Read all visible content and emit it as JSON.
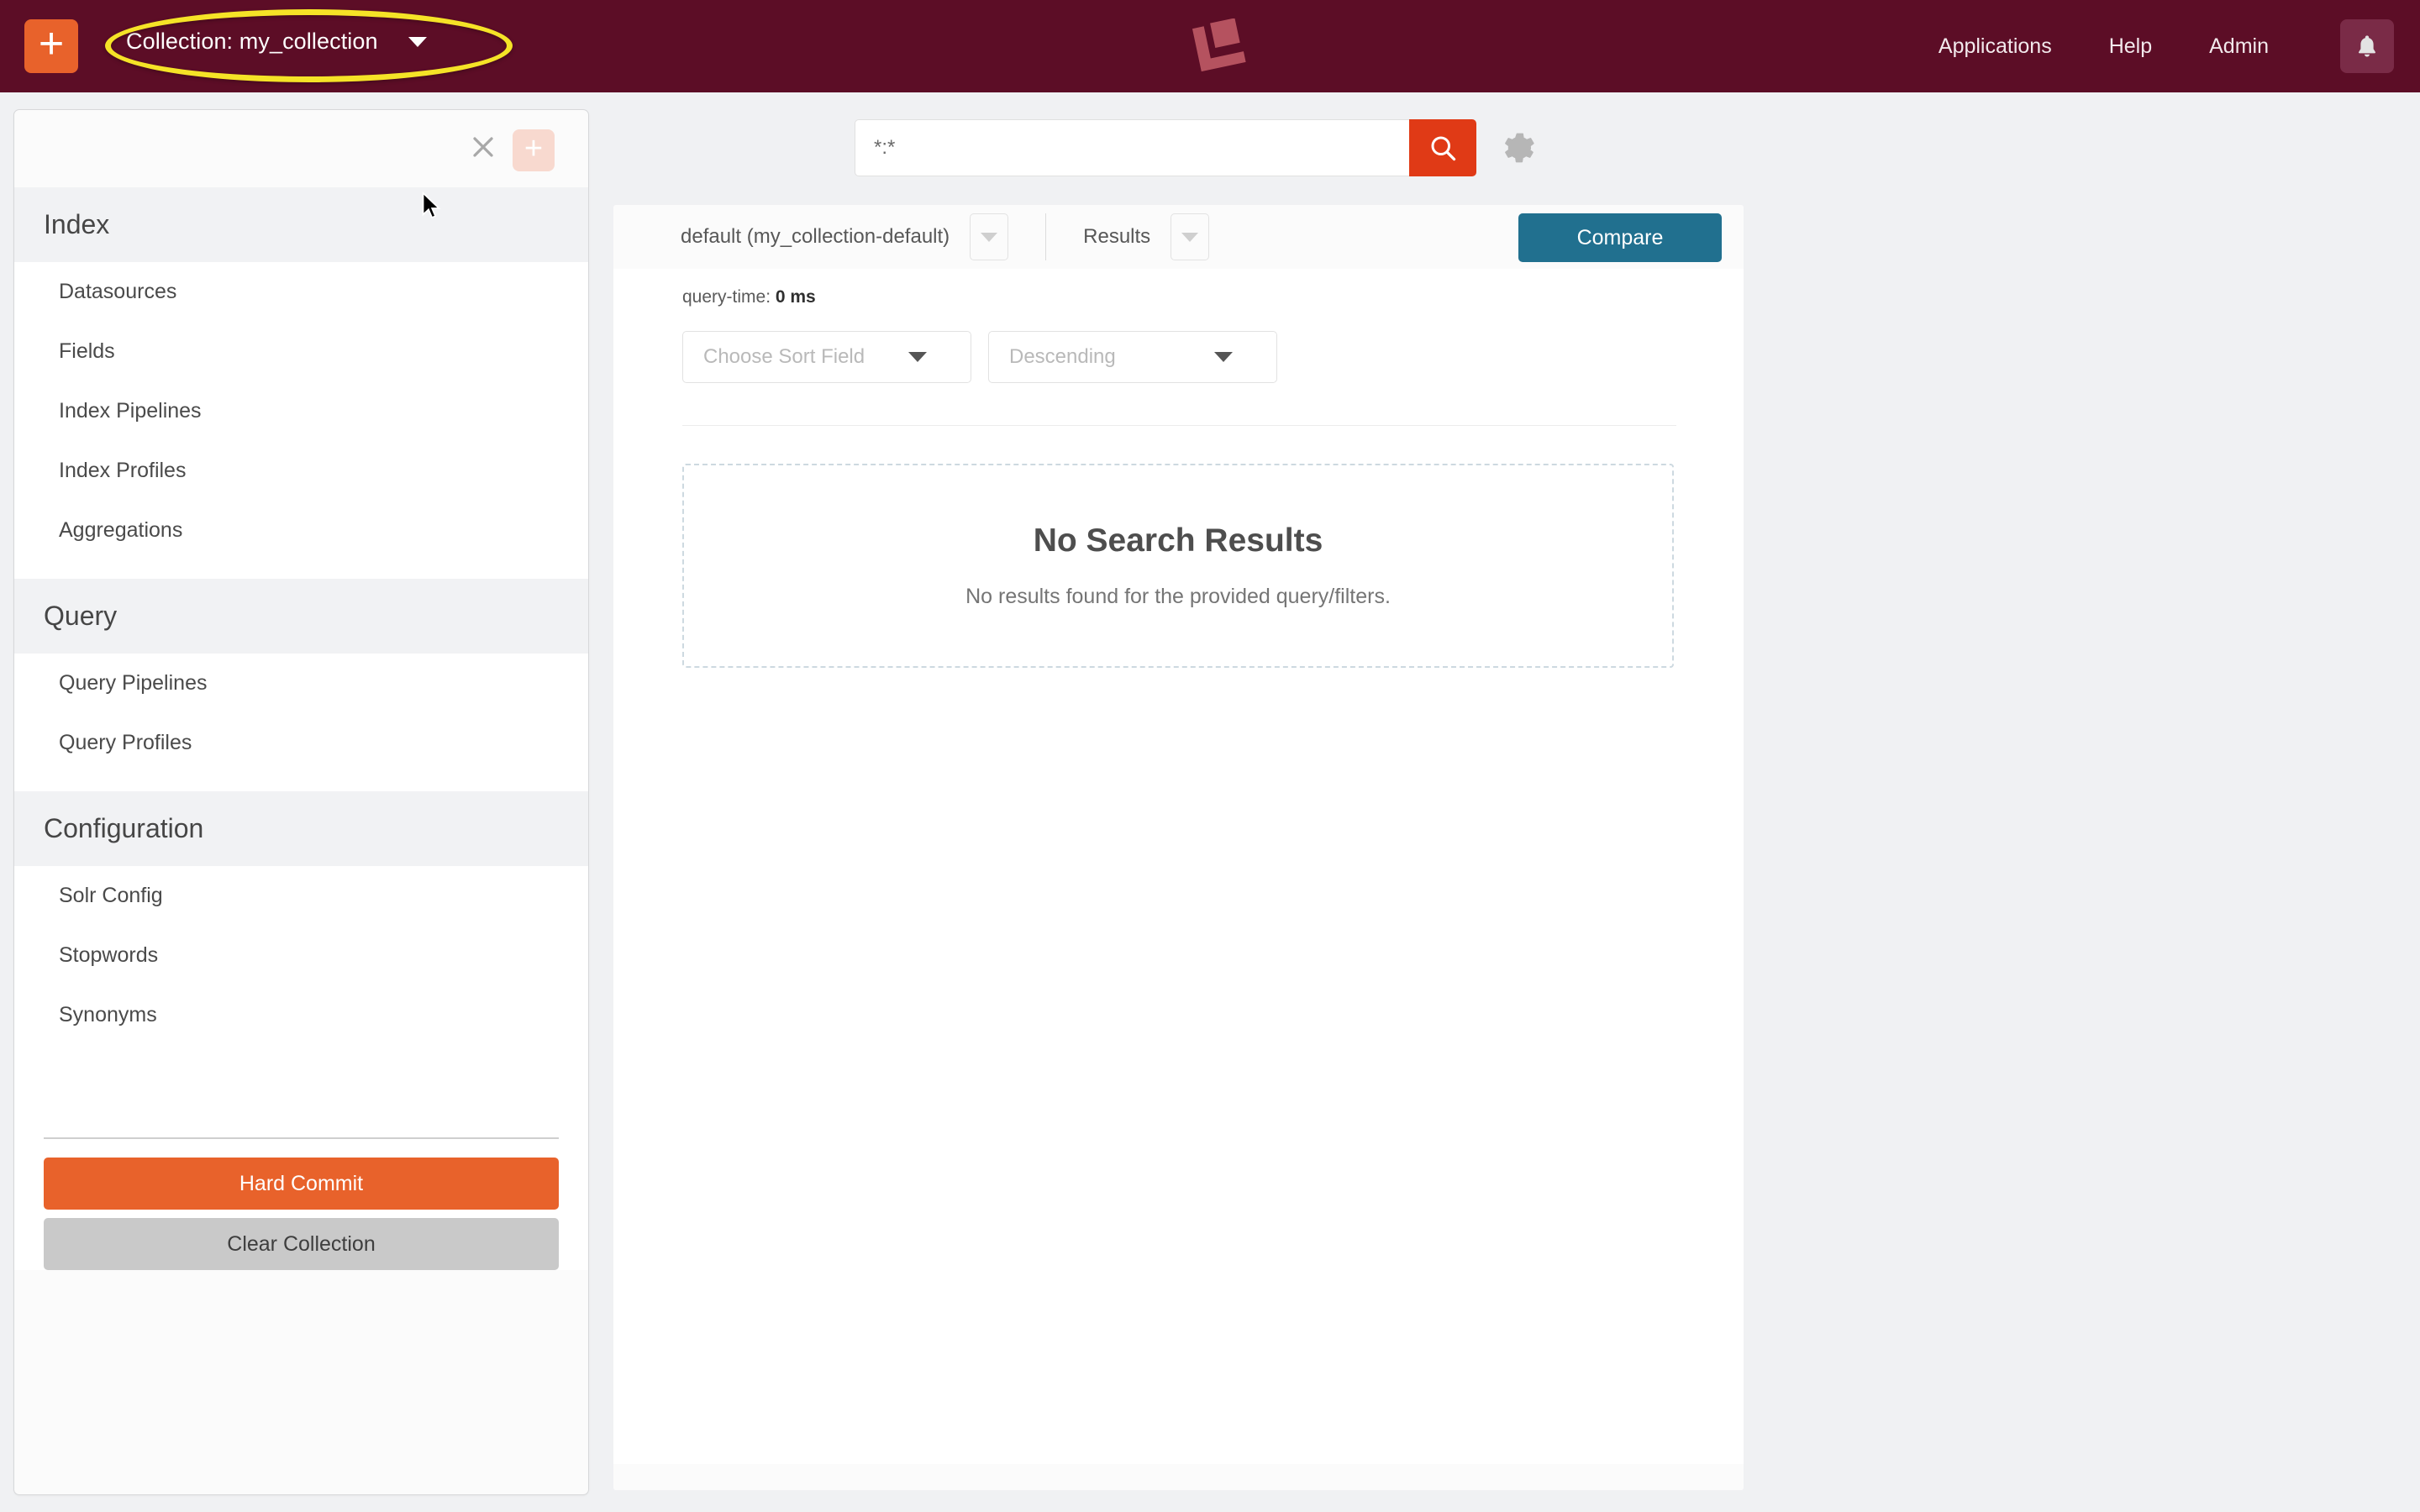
{
  "topnav": {
    "add_icon": "plus-icon",
    "collection_label": "Collection: my_collection",
    "collection_caret": "chevron-down-icon",
    "logo": "lucidworks-logo",
    "links": [
      {
        "label": "Applications",
        "name": "applications"
      },
      {
        "label": "Help",
        "name": "help"
      },
      {
        "label": "Admin",
        "name": "admin"
      }
    ],
    "bell_icon": "bell-icon",
    "bg_color": "#5c0d26",
    "accent_color": "#e8622b",
    "annotation_color": "#f5e327"
  },
  "sidebar": {
    "close_icon": "close-icon",
    "add_icon": "plus-icon",
    "sections": [
      {
        "title": "Index",
        "items": [
          {
            "label": "Datasources",
            "name": "datasources"
          },
          {
            "label": "Fields",
            "name": "fields"
          },
          {
            "label": "Index Pipelines",
            "name": "index-pipelines"
          },
          {
            "label": "Index Profiles",
            "name": "index-profiles"
          },
          {
            "label": "Aggregations",
            "name": "aggregations"
          }
        ]
      },
      {
        "title": "Query",
        "items": [
          {
            "label": "Query Pipelines",
            "name": "query-pipelines"
          },
          {
            "label": "Query Profiles",
            "name": "query-profiles"
          }
        ]
      },
      {
        "title": "Configuration",
        "items": [
          {
            "label": "Solr Config",
            "name": "solr-config"
          },
          {
            "label": "Stopwords",
            "name": "stopwords"
          },
          {
            "label": "Synonyms",
            "name": "synonyms"
          }
        ]
      }
    ],
    "hard_commit_label": "Hard Commit",
    "clear_collection_label": "Clear Collection",
    "hard_commit_color": "#e8622b",
    "clear_collection_color": "#c9c9c9"
  },
  "search": {
    "value": "*:*",
    "placeholder": "",
    "search_icon": "search-icon",
    "settings_icon": "gear-icon",
    "button_color": "#e03a16"
  },
  "main": {
    "profile_label": "default (my_collection-default)",
    "profile_caret": "chevron-down-icon",
    "view_label": "Results",
    "view_caret": "chevron-down-icon",
    "compare_label": "Compare",
    "compare_color": "#21708f",
    "query_time_label": "query-time:",
    "query_time_value": "0 ms",
    "sort_field_placeholder": "Choose Sort Field",
    "sort_direction_value": "Descending",
    "no_results_title": "No Search Results",
    "no_results_subtitle": "No results found for the provided query/filters."
  }
}
